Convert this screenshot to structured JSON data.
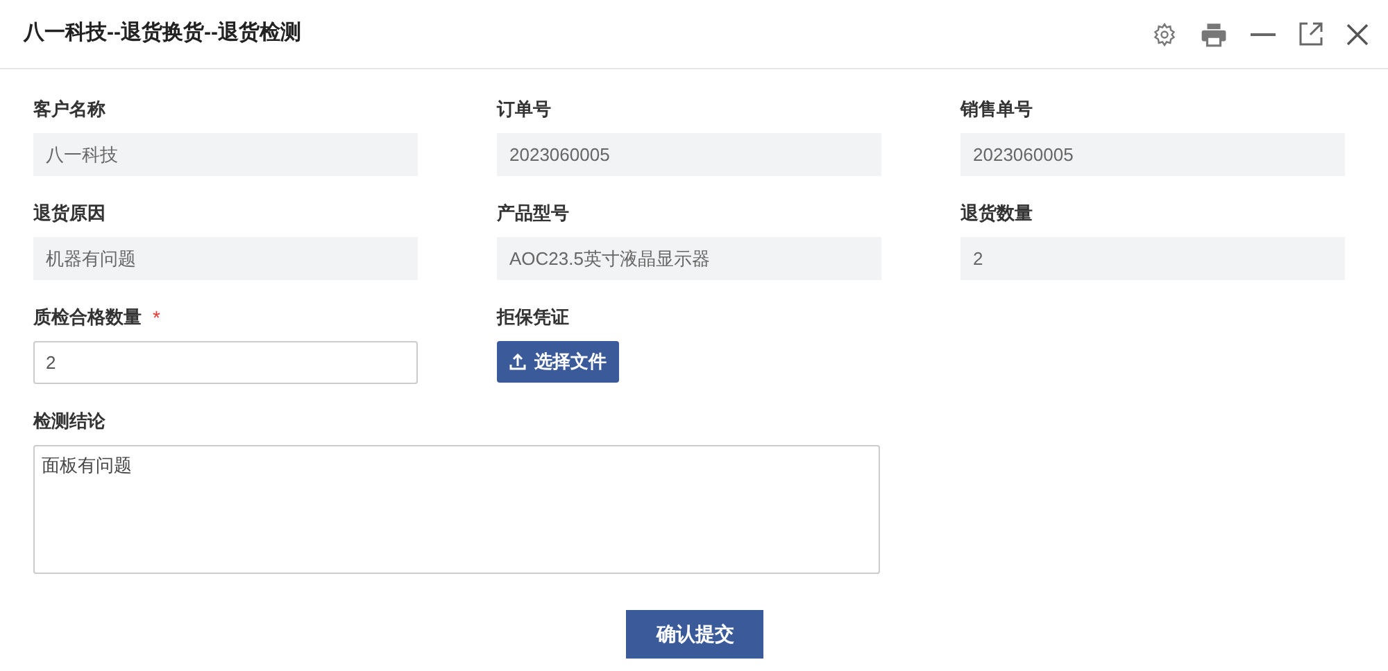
{
  "window": {
    "title": "八一科技--退货换货--退货检测"
  },
  "fields": [
    {
      "label": "客户名称",
      "kind": "readonly",
      "value": "八一科技"
    },
    {
      "label": "订单号",
      "kind": "readonly",
      "value": "2023060005"
    },
    {
      "label": "销售单号",
      "kind": "readonly",
      "value": "2023060005"
    },
    {
      "label": "退货原因",
      "kind": "readonly",
      "value": "机器有问题"
    },
    {
      "label": "产品型号",
      "kind": "readonly",
      "value": "AOC23.5英寸液晶显示器"
    },
    {
      "label": "退货数量",
      "kind": "readonly",
      "value": "2"
    },
    {
      "label": "质检合格数量",
      "kind": "input",
      "value": "2",
      "required_mark": "*"
    },
    {
      "label": "拒保凭证",
      "kind": "upload",
      "button": "选择文件"
    },
    {
      "label": "检测结论",
      "kind": "textarea",
      "value": "面板有问题"
    }
  ],
  "submit_button": "确认提交"
}
